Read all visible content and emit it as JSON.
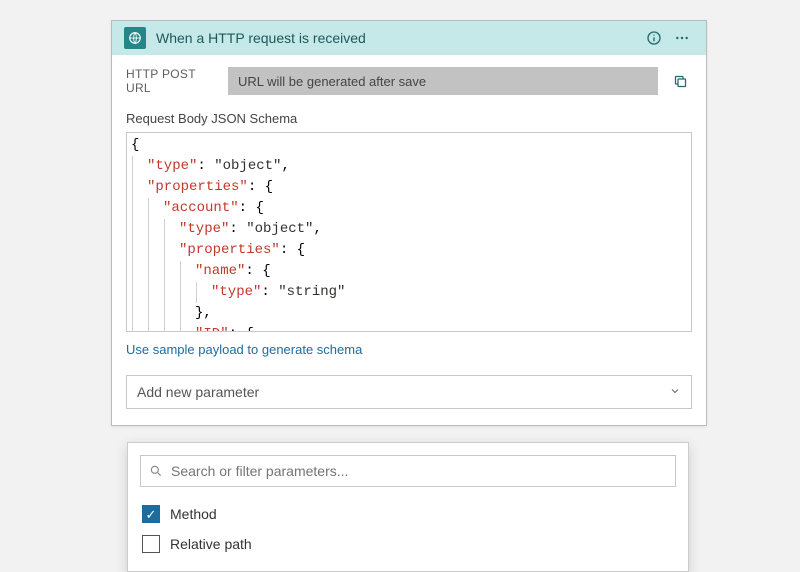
{
  "card": {
    "title": "When a HTTP request is received",
    "urlLabel": "HTTP POST URL",
    "urlValue": "URL will be generated after save",
    "schemaLabel": "Request Body JSON Schema",
    "sampleLink": "Use sample payload to generate schema",
    "addParam": "Add new parameter"
  },
  "schema": {
    "raw": "{\n    \"type\": \"object\",\n    \"properties\": {\n        \"account\": {\n            \"type\": \"object\",\n            \"properties\": {\n                \"name\": {\n                    \"type\": \"string\"\n                },\n                \"ID\": {\n"
  },
  "search": {
    "placeholder": "Search or filter parameters..."
  },
  "options": [
    {
      "label": "Method",
      "checked": true
    },
    {
      "label": "Relative path",
      "checked": false
    }
  ]
}
